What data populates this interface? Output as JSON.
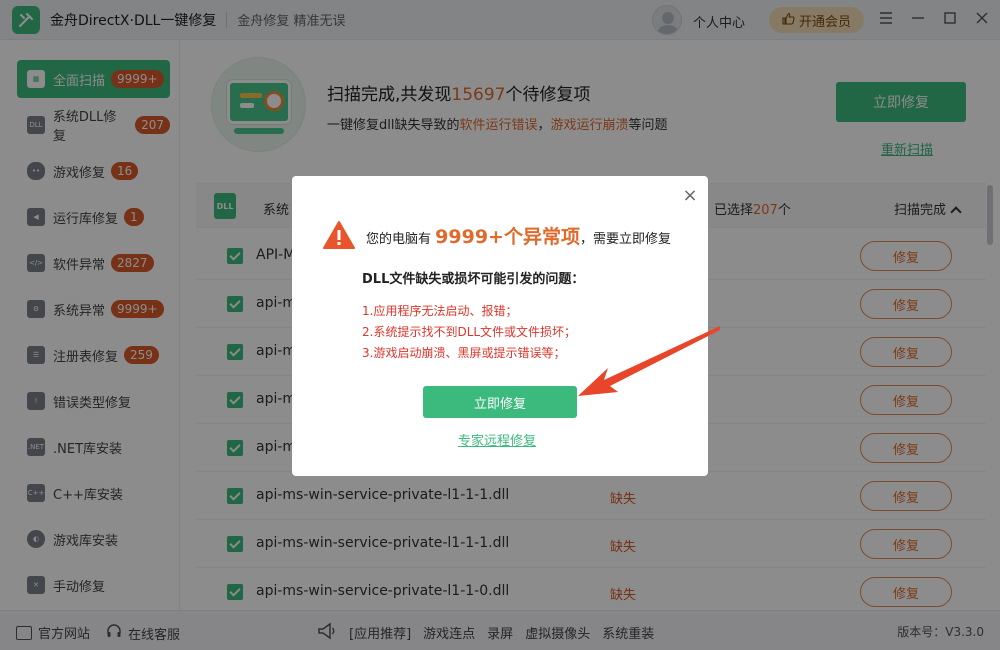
{
  "titlebar": {
    "app_title": "金舟DirectX·DLL一键修复",
    "app_subtitle": "金舟修复 精准无误",
    "user_center": "个人中心",
    "vip_label": "开通会员"
  },
  "sidebar": {
    "items": [
      {
        "label": "全面扫描",
        "badge": "9999+",
        "icon": "scan-icon"
      },
      {
        "label": "系统DLL修复",
        "badge": "207",
        "icon": "dll-icon"
      },
      {
        "label": "游戏修复",
        "badge": "16",
        "icon": "gamepad-icon"
      },
      {
        "label": "运行库修复",
        "badge": "1",
        "icon": "runtime-icon"
      },
      {
        "label": "软件异常",
        "badge": "2827",
        "icon": "software-icon"
      },
      {
        "label": "系统异常",
        "badge": "9999+",
        "icon": "gear-icon"
      },
      {
        "label": "注册表修复",
        "badge": "259",
        "icon": "registry-icon"
      },
      {
        "label": "错误类型修复",
        "badge": "",
        "icon": "warning-icon"
      },
      {
        "label": ".NET库安装",
        "badge": "",
        "icon": "dotnet-icon"
      },
      {
        "label": "C++库安装",
        "badge": "",
        "icon": "cpp-icon"
      },
      {
        "label": "游戏库安装",
        "badge": "",
        "icon": "game-lib-icon"
      },
      {
        "label": "手动修复",
        "badge": "",
        "icon": "wrench-icon"
      }
    ]
  },
  "main": {
    "scan_title_prefix": "扫描完成,共发现",
    "scan_count": "15697",
    "scan_title_suffix": "个待修复项",
    "desc_prefix": "一键修复dll缺失导致的",
    "desc_hl1": "软件运行错误",
    "desc_sep": "，",
    "desc_hl2": "游戏运行崩溃",
    "desc_suffix": "等问题",
    "fix_now": "立即修复",
    "rescan": "重新扫描",
    "table": {
      "col_system": "系统",
      "selected_prefix": "已选择",
      "selected_count": "207",
      "selected_suffix": "个",
      "status_done": "扫描完成",
      "rows": [
        {
          "name": "API-M",
          "status": "",
          "button": "修复"
        },
        {
          "name": "api-m",
          "status": "",
          "button": "修复"
        },
        {
          "name": "api-m",
          "status": "",
          "button": "修复"
        },
        {
          "name": "api-m",
          "status": "",
          "button": "修复"
        },
        {
          "name": "api-m",
          "status": "",
          "button": "修复"
        },
        {
          "name": "api-ms-win-service-private-l1-1-1.dll",
          "status": "缺失",
          "button": "修复"
        },
        {
          "name": "api-ms-win-service-private-l1-1-1.dll",
          "status": "缺失",
          "button": "修复"
        },
        {
          "name": "api-ms-win-service-private-l1-1-0.dll",
          "status": "缺失",
          "button": "修复"
        }
      ]
    }
  },
  "footer": {
    "official_site": "官方网站",
    "online_service": "在线客服",
    "links": [
      "[应用推荐]",
      "游戏连点",
      "录屏",
      "虚拟摄像头",
      "系统重装"
    ],
    "version": "版本号：V3.3.0"
  },
  "modal": {
    "title_prefix": "您的电脑有",
    "title_count": "9999+个异常项",
    "title_suffix": "，需要立即修复",
    "question": "DLL文件缺失或损坏可能引发的问题：",
    "issues": [
      "1.应用程序无法启动、报错；",
      "2.系统提示找不到DLL文件或文件损坏；",
      "3.游戏启动崩溃、黑屏或提示错误等；"
    ],
    "fix_button": "立即修复",
    "remote_link": "专家远程修复"
  },
  "colors": {
    "accent": "#3cba7e",
    "highlight": "#e06a2b",
    "danger": "#e0352b",
    "arrow": "#e8452b"
  }
}
